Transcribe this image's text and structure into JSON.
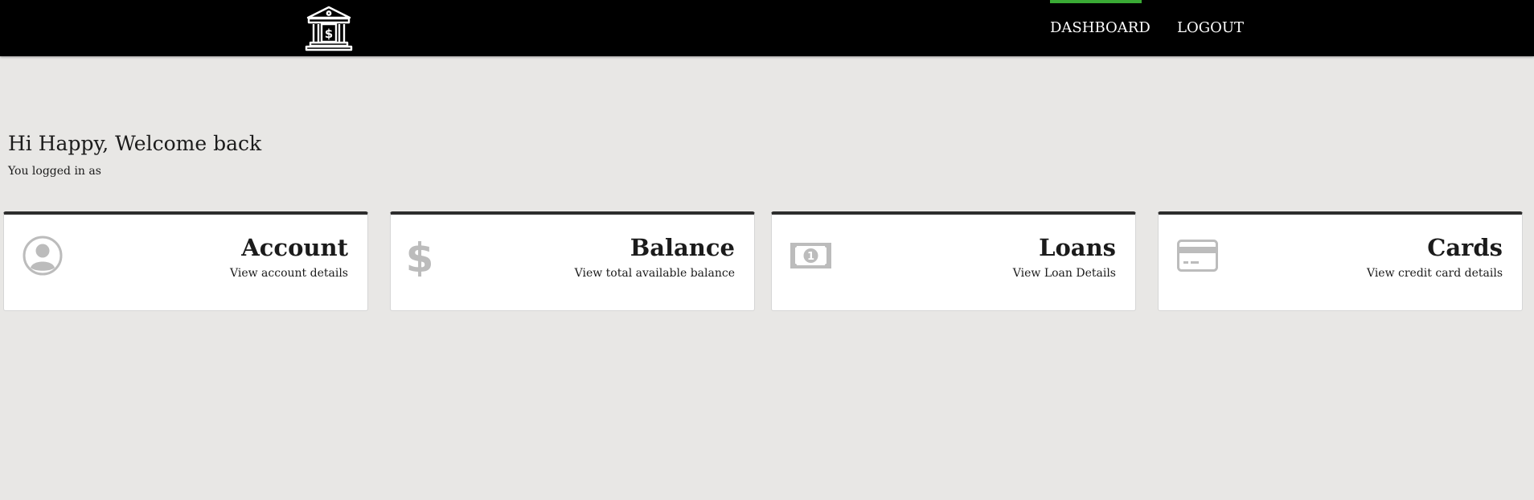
{
  "header": {
    "logo_icon": "bank-icon",
    "nav": [
      {
        "label": "DASHBOARD",
        "active": true
      },
      {
        "label": "LOGOUT",
        "active": false
      }
    ],
    "active_indicator_color": "#3aaa35"
  },
  "welcome": {
    "greeting": "Hi Happy, Welcome back",
    "subtext": "You logged in as"
  },
  "cards": [
    {
      "title": "Account",
      "description": "View account details",
      "icon": "user-icon"
    },
    {
      "title": "Balance",
      "description": "View total available balance",
      "icon": "dollar-icon"
    },
    {
      "title": "Loans",
      "description": "View Loan Details",
      "icon": "money-bill-icon"
    },
    {
      "title": "Cards",
      "description": "View credit card details",
      "icon": "credit-card-icon"
    }
  ]
}
